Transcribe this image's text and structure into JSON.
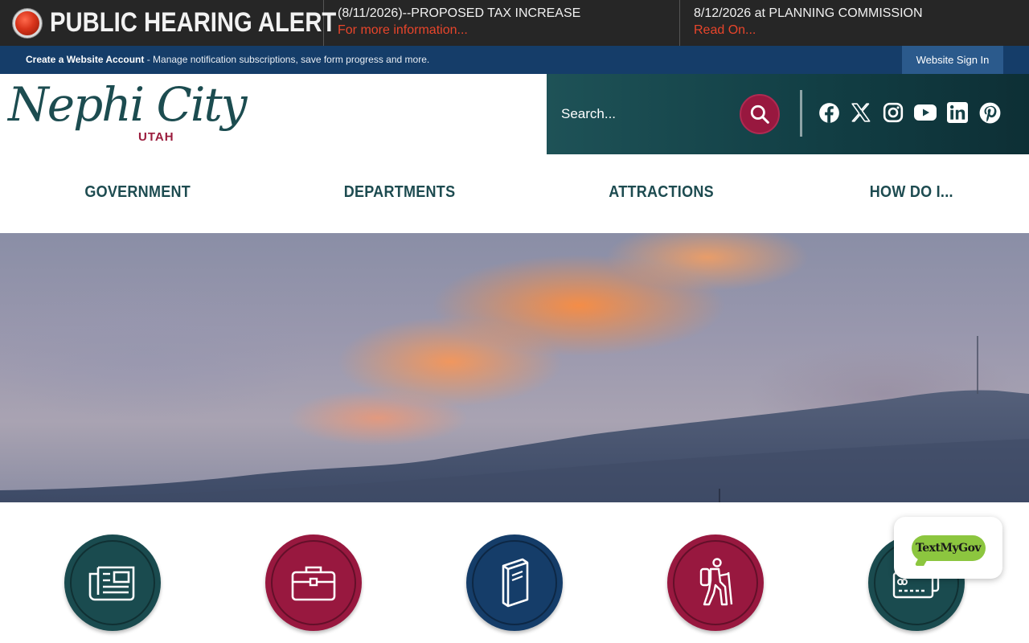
{
  "alert": {
    "title": "PUBLIC HEARING ALERT",
    "items": [
      {
        "headline": "(8/11/2026)--PROPOSED TAX INCREASE",
        "link": "For more information..."
      },
      {
        "headline": "8/12/2026 at PLANNING COMMISSION",
        "link": "Read On..."
      }
    ]
  },
  "account_bar": {
    "create_label": "Create a Website Account",
    "description": " - Manage notification subscriptions, save form progress and more.",
    "signin_label": "Website Sign In"
  },
  "header": {
    "logo_script": "Nephi City",
    "logo_state": "UTAH",
    "search_placeholder": "Search...",
    "social_icons": [
      "facebook-icon",
      "x-twitter-icon",
      "instagram-icon",
      "youtube-icon",
      "linkedin-icon",
      "pinterest-icon"
    ]
  },
  "nav": {
    "items": [
      "GOVERNMENT",
      "DEPARTMENTS",
      "ATTRACTIONS",
      "HOW DO I..."
    ]
  },
  "quick_links": [
    {
      "icon": "newspaper-icon",
      "color": "#1a4b4f"
    },
    {
      "icon": "briefcase-icon",
      "color": "#98183f"
    },
    {
      "icon": "book-icon",
      "color": "#153d69"
    },
    {
      "icon": "hiker-icon",
      "color": "#98183f"
    },
    {
      "icon": "payment-card-icon",
      "color": "#1a4b4f"
    }
  ],
  "textmygov": {
    "label": "TextMyGov"
  },
  "colors": {
    "alert_bg": "#262626",
    "alert_link": "#e8452b",
    "account_bar": "#153d69",
    "teal": "#1a4b4f",
    "crimson": "#98183f",
    "navy": "#153d69"
  }
}
